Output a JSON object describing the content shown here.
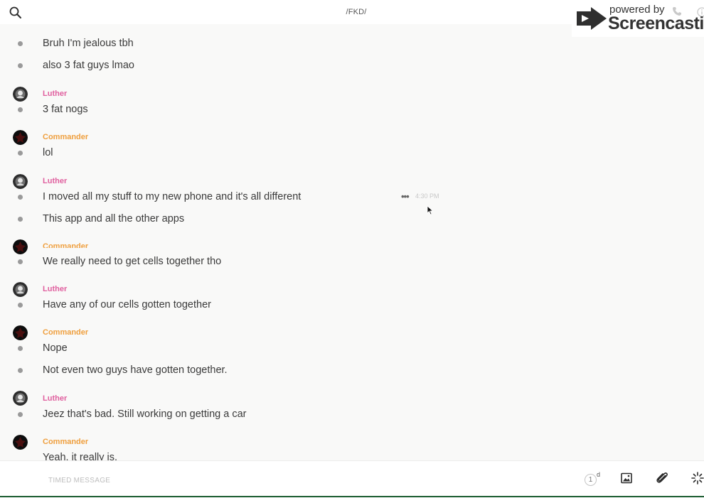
{
  "header": {
    "channel_title": "/FKD/",
    "search_icon": "search-icon"
  },
  "watermark": {
    "powered_by": "powered by",
    "brand": "Screencastify"
  },
  "authors": {
    "luther": {
      "name": "Luther",
      "color": "#e0609f"
    },
    "commander": {
      "name": "Commander",
      "color": "#ef9f3e"
    }
  },
  "messages": [
    "Bruh I'm jealous tbh",
    "also 3 fat guys lmao",
    "3 fat nogs",
    "lol",
    "I moved all my stuff to my new phone and it's all different",
    "This app and all the other apps",
    "We really need to get cells together tho",
    "Have any of our cells gotten together",
    "Nope",
    "Not even two guys have gotten together.",
    "Jeez that's bad. Still working on getting a car",
    "Yeah. it really is."
  ],
  "hover": {
    "more_label": "•••",
    "timestamp": "4:30 PM"
  },
  "composer": {
    "placeholder": "TIMED MESSAGE",
    "value": "",
    "timer_value": "1",
    "timer_unit": "d"
  }
}
